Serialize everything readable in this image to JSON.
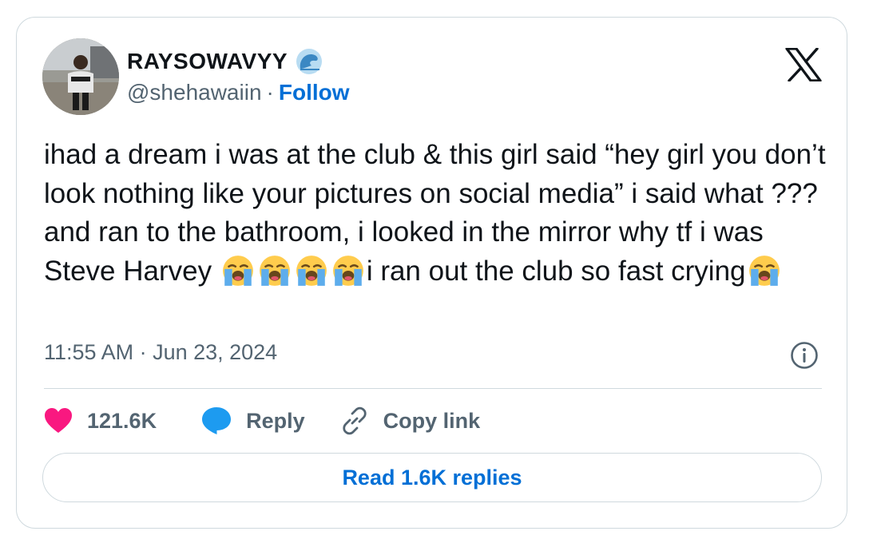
{
  "author": {
    "display_name": "RAYSOWAVYY",
    "handle": "@shehawaiin",
    "separator": "·",
    "follow_label": "Follow",
    "avatar_icon": "profile-photo",
    "badge_icon": "water-wave-icon"
  },
  "tweet": {
    "text_parts": [
      "ihad a dream i was at the club & this girl said “hey girl you don’t look nothing like your pictures on social media” i said what ??? and ran to the bathroom, i looked in the mirror why tf i was Steve Harvey ",
      "i ran out the club so fast crying"
    ],
    "emoji_name": "loudly-crying-face",
    "timestamp": "11:55 AM · Jun 23, 2024"
  },
  "actions": {
    "like_count": "121.6K",
    "reply_label": "Reply",
    "copy_link_label": "Copy link"
  },
  "read_replies_label": "Read 1.6K replies",
  "colors": {
    "link_blue": "#006fd6",
    "like_pink": "#f91880",
    "reply_blue": "#1d9bf0",
    "muted": "#536471",
    "border": "#cfd9de"
  }
}
